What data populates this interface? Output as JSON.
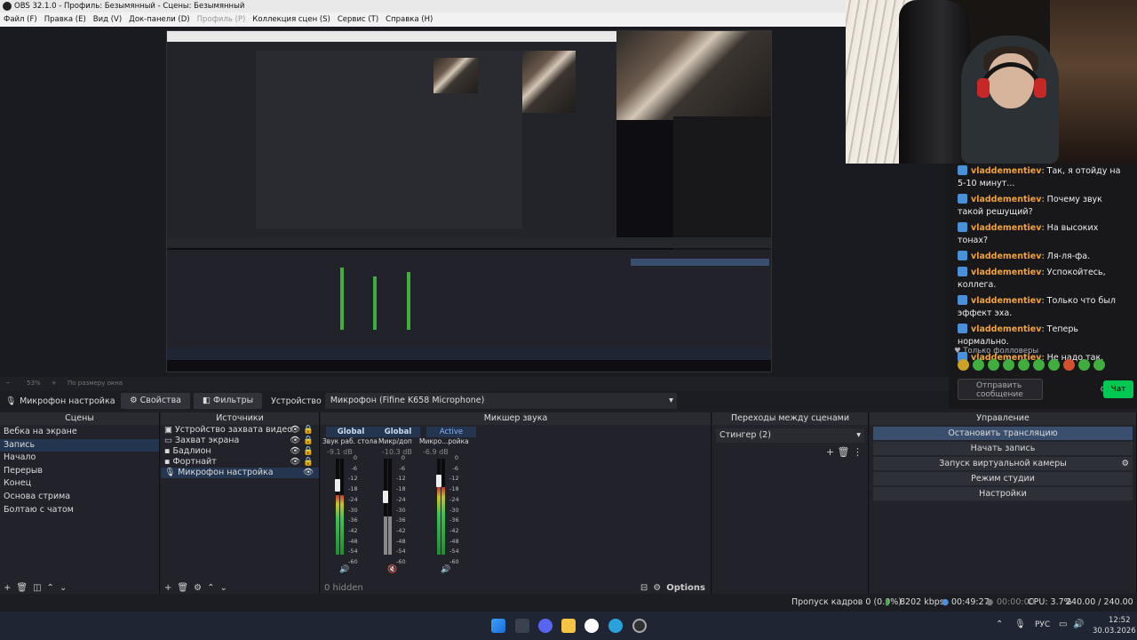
{
  "window": {
    "title": "OBS 32.1.0 - Профиль: Безымянный - Сцены: Безымянный"
  },
  "menu": [
    {
      "label": "Файл (F)",
      "enabled": true
    },
    {
      "label": "Правка (E)",
      "enabled": true
    },
    {
      "label": "Вид (V)",
      "enabled": true
    },
    {
      "label": "Док-панели (D)",
      "enabled": true
    },
    {
      "label": "Профиль (P)",
      "enabled": false
    },
    {
      "label": "Коллекция сцен (S)",
      "enabled": true
    },
    {
      "label": "Сервис (T)",
      "enabled": true
    },
    {
      "label": "Справка (H)",
      "enabled": true
    }
  ],
  "zoom": {
    "value": "53%",
    "fit_label": "По размеру окна"
  },
  "source_toolbar": {
    "source_name": "Микрофон настройка",
    "properties_label": "Свойства",
    "filters_label": "Фильтры",
    "device_label": "Устройство",
    "device_value": "Микрофон (Fifine K658  Microphone)"
  },
  "scenes": {
    "title": "Сцены",
    "items": [
      "Вебка на экране",
      "Запись",
      "Начало",
      "Перерыв",
      "Конец",
      "Основа стрима",
      "Болтаю с чатом"
    ],
    "active_index": 1
  },
  "sources": {
    "title": "Источники",
    "items": [
      "Устройство захвата видео",
      "Захват экрана",
      "Бадлион",
      "Фортнайт",
      "Микрофон настройка"
    ],
    "active_index": 4
  },
  "mixer": {
    "title": "Микшер звука",
    "hidden_label": "0 hidden",
    "options_label": "Options",
    "channels": [
      {
        "badge": "Global",
        "name": "Звук раб. стола",
        "db": "-9.1 dB",
        "level": 0.62,
        "muted": false
      },
      {
        "badge": "Global",
        "name": "Микр/доп",
        "db": "-10.3 dB",
        "level": 0.4,
        "muted": true
      },
      {
        "badge": "Active",
        "name": "Микро...ройка",
        "db": "-6.9 dB",
        "level": 0.7,
        "muted": false
      }
    ],
    "scale": [
      "0",
      "-6",
      "-12",
      "-18",
      "-24",
      "-30",
      "-36",
      "-42",
      "-48",
      "-54",
      "-60"
    ]
  },
  "transitions": {
    "title": "Переходы между сценами",
    "value": "Стингер (2)"
  },
  "controls": {
    "title": "Управление",
    "buttons": [
      "Остановить трансляцию",
      "Начать запись",
      "Запуск виртуальной камеры",
      "Режим студии",
      "Настройки"
    ]
  },
  "status": {
    "dropped": "Пропуск кадров 0 (0.0%)",
    "bitrate": "8202 kbps",
    "stream_time": "00:49:27",
    "rec_time": "00:00:00",
    "cpu": "CPU: 3.7%",
    "fps": "240.00 / 240.00 FPS"
  },
  "chat": {
    "messages": [
      {
        "user": "vladdementiev",
        "text": ": Так, я отойду на 5-10 минут..."
      },
      {
        "user": "vladdementiev",
        "text": ": Почему звук такой решущий?"
      },
      {
        "user": "vladdementiev",
        "text": ": На высоких тонах?"
      },
      {
        "user": "vladdementiev",
        "text": ": Ля-ля-фа."
      },
      {
        "user": "vladdementiev",
        "text": ": Успокойтесь, коллега."
      },
      {
        "user": "vladdementiev",
        "text": ": Только что был эффект эха."
      },
      {
        "user": "vladdementiev",
        "text": ": Теперь нормально."
      },
      {
        "user": "vladdementiev",
        "text": ": Не надо так."
      }
    ],
    "followers_label": "Только фолловеры",
    "input_placeholder": "Отправить сообщение",
    "send_label": "Чат"
  },
  "taskbar": {
    "lang": "РУС",
    "time": "12:52",
    "date": "30.03.2026"
  },
  "colors": {
    "accent_active": "#23354f",
    "chat_user": "#f0a33d",
    "chat_send": "#00c853"
  }
}
